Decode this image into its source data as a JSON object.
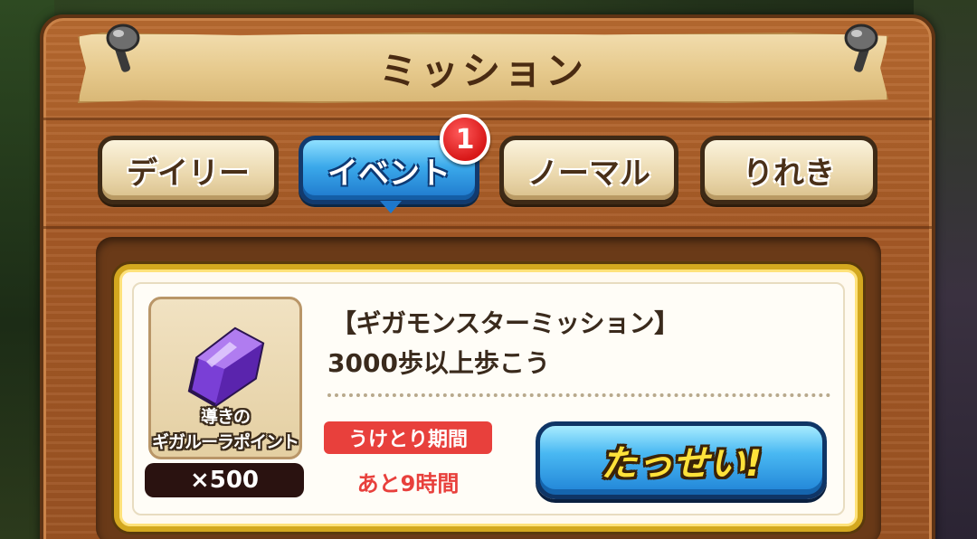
{
  "header": {
    "title": "ミッション"
  },
  "tabs": [
    {
      "label": "デイリー",
      "active": false
    },
    {
      "label": "イベント",
      "active": true,
      "badge": "1"
    },
    {
      "label": "ノーマル",
      "active": false
    },
    {
      "label": "りれき",
      "active": false
    }
  ],
  "mission": {
    "title": "【ギガモンスターミッション】",
    "description": "3000歩以上歩こう",
    "reward": {
      "name_line1": "導きの",
      "name_line2": "ギガルーラポイント",
      "quantity": "×500",
      "icon": "purple-crystal-icon"
    },
    "period_label": "うけとり期間",
    "remaining": "あと9時間",
    "action_label": "たっせい!"
  },
  "colors": {
    "wood": "#a65a26",
    "parchment": "#e6c98c",
    "active_tab": "#3aa8ea",
    "badge": "#d81818",
    "period": "#e8403c",
    "card_border": "#d3a81f"
  }
}
